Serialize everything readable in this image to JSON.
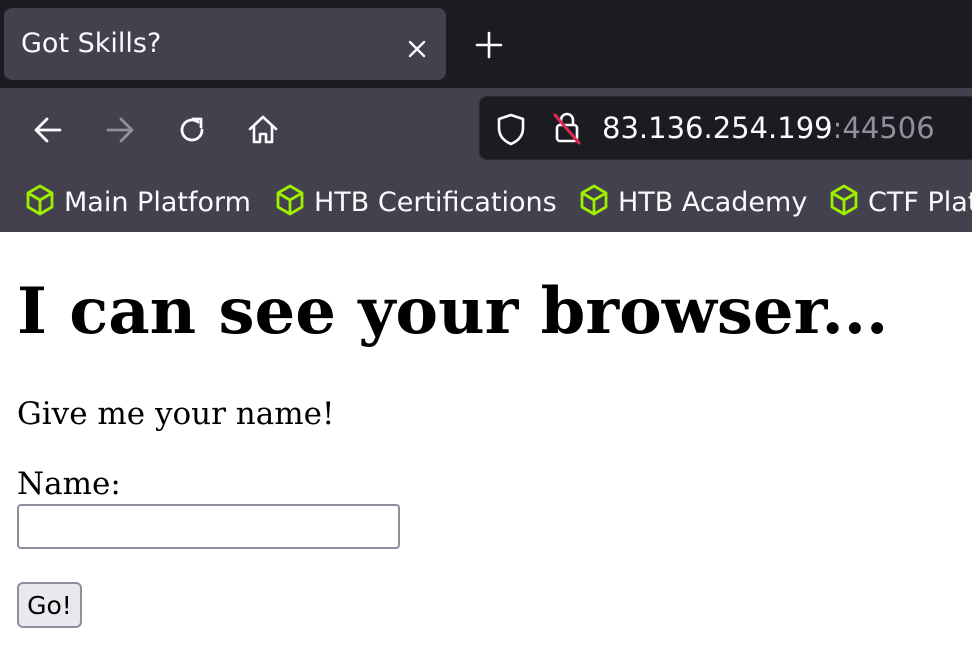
{
  "browser": {
    "tab": {
      "title": "Got Skills?",
      "close_icon": "close-icon"
    },
    "new_tab_icon": "plus-icon",
    "nav": {
      "back_icon": "arrow-left-icon",
      "forward_icon": "arrow-right-icon",
      "reload_icon": "reload-icon",
      "home_icon": "home-icon"
    },
    "url": {
      "host": "83.136.254.199",
      "port": ":44506",
      "shield_icon": "shield-icon",
      "insecure_icon": "insecure-lock-icon"
    },
    "bookmarks": [
      {
        "label": "Main Platform",
        "icon": "cube-icon"
      },
      {
        "label": "HTB Certifications",
        "icon": "cube-icon"
      },
      {
        "label": "HTB Academy",
        "icon": "cube-icon"
      },
      {
        "label": "CTF Platform",
        "icon": "cube-icon"
      }
    ],
    "colors": {
      "chrome": "#42414d",
      "tabstrip": "#1c1b22",
      "bookmark_icon": "#9fef00"
    }
  },
  "page": {
    "heading": "I can see your browser...",
    "prompt": "Give me your name!",
    "name_label": "Name:",
    "name_value": "",
    "submit_label": "Go!"
  }
}
